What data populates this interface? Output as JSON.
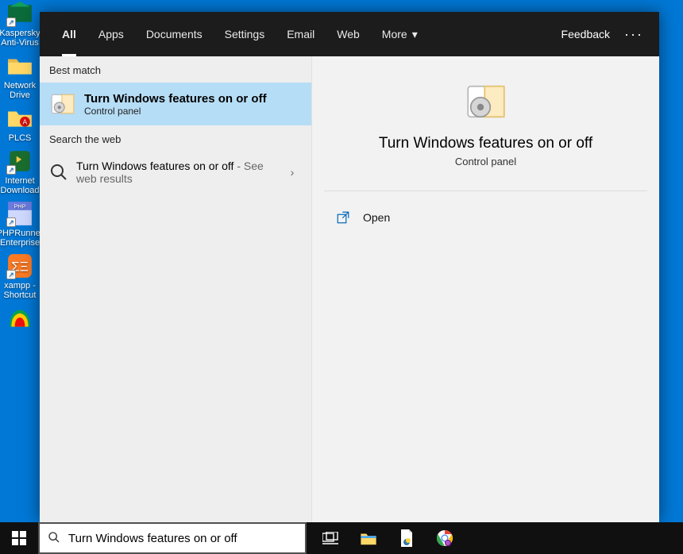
{
  "desktop": {
    "items": [
      {
        "label": "Kaspersky Anti-Virus"
      },
      {
        "label": "Network Drive"
      },
      {
        "label": "PLCS"
      },
      {
        "label": "Internet Download"
      },
      {
        "label": "PHPRunner Enterprise"
      },
      {
        "label": "xampp - Shortcut"
      },
      {
        "label": ""
      }
    ]
  },
  "search": {
    "value": "Turn Windows features on or off",
    "tabs": {
      "all": "All",
      "apps": "Apps",
      "documents": "Documents",
      "settings": "Settings",
      "email": "Email",
      "web": "Web",
      "more": "More"
    },
    "feedback": "Feedback",
    "sections": {
      "best_match": "Best match",
      "search_web": "Search the web"
    },
    "best_match_result": {
      "title": "Turn Windows features on or off",
      "subtitle": "Control panel"
    },
    "web_result": {
      "title": "Turn Windows features on or off",
      "suffix": " - See web results"
    },
    "preview": {
      "title": "Turn Windows features on or off",
      "subtitle": "Control panel",
      "actions": {
        "open": "Open"
      }
    }
  }
}
